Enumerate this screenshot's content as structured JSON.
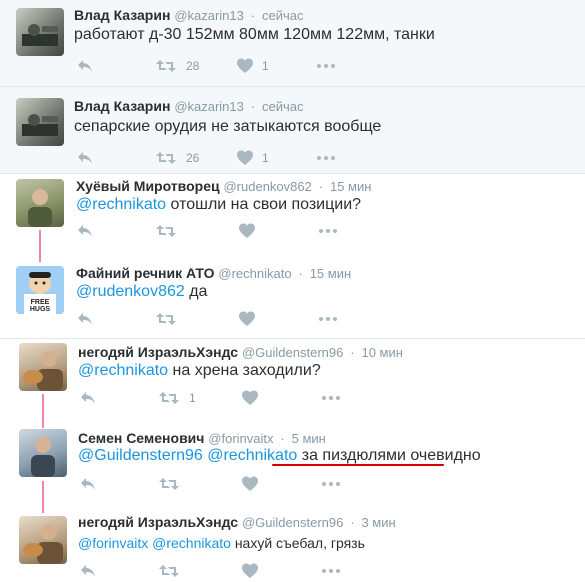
{
  "colors": {
    "accent": "#1b95e0",
    "muted": "#8899a6",
    "thread": "#e0245e"
  },
  "tweets": [
    {
      "name": "Влад Казарин",
      "handle": "@kazarin13",
      "time": "сейчас",
      "text": "работают д-30 152мм 80мм 120мм 122мм, танки",
      "retweets": "28",
      "likes": "1",
      "avatar": "military-photo"
    },
    {
      "name": "Влад Казарин",
      "handle": "@kazarin13",
      "time": "сейчас",
      "text": "сепарские орудия не затыкаются вообще",
      "retweets": "26",
      "likes": "1",
      "avatar": "military-photo"
    },
    {
      "name": "Хуёвый Миротворец",
      "handle": "@rudenkov862",
      "time": "15 мин",
      "mention": "@rechnikato",
      "text": "отошли на свои позиции?",
      "avatar": "person-photo"
    },
    {
      "name": "Файний речник АТО",
      "handle": "@rechnikato",
      "time": "15 мин",
      "mention": "@rudenkov862",
      "text": "да",
      "avatar": "cartoon-free-hugs"
    },
    {
      "name": "негодяй ИзраэльХэндс",
      "handle": "@Guildenstern96",
      "time": "10 мин",
      "mention": "@rechnikato",
      "text": "на хрена заходили?",
      "retweets": "1",
      "avatar": "cat-person-photo"
    },
    {
      "name": "Семен Семенович",
      "handle": "@forinvaitx",
      "time": "5 мин",
      "mention": "@Guildenstern96",
      "mention2": "@rechnikato",
      "text": "за пиздюлями очевидно",
      "avatar": "person-photo"
    },
    {
      "name": "негодяй ИзраэльХэндс",
      "handle": "@Guildenstern96",
      "time": "3 мин",
      "mention": "@forinvaitx",
      "mention2": "@rechnikato",
      "text": "нахуй съебал, грязь",
      "avatar": "cat-person-photo"
    }
  ]
}
